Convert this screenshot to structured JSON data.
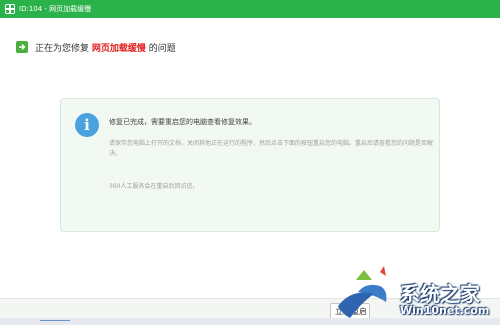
{
  "window": {
    "title": "ID:104 - 网页加载缓慢"
  },
  "status": {
    "prefix": "正在为您修复",
    "highlight": "网页加载缓慢",
    "suffix": "的问题",
    "highlight_color": "#e0211f"
  },
  "message": {
    "icon": "info-icon",
    "title": "修复已完成，需要重启您的电脑查看修复效果。",
    "body": "请保存您电脑上打开的文档，关闭其他正在运行的程序，然后点击下面的按钮重启您的电脑。重启后请查看您的问题是否解决。",
    "note": "360人工服务会在重启后回访您。"
  },
  "actions": {
    "restart_label": "立即重启"
  },
  "watermark": {
    "text": "系统之家",
    "url": "Win10net.com"
  },
  "colors": {
    "titlebar": "#2bb24a",
    "accent_green": "#4cae3f",
    "info_blue": "#4aa3e0",
    "card_bg": "#f2f9f3"
  }
}
